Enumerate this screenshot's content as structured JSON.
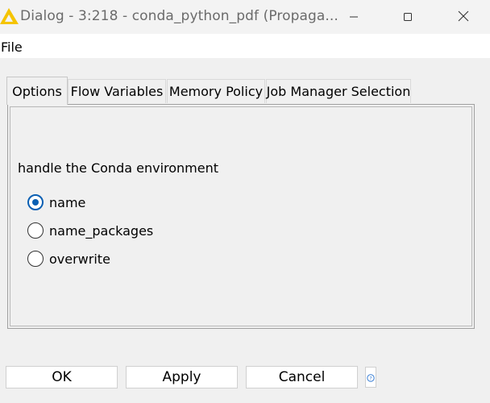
{
  "window": {
    "title": "Dialog - 3:218 - conda_python_pdf (Propaga...",
    "app_icon": "warning-triangle-icon",
    "controls": [
      "minimize-icon",
      "maximize-icon",
      "close-icon"
    ]
  },
  "menubar": {
    "items": [
      {
        "label": "File"
      }
    ]
  },
  "tabs": [
    {
      "label": "Options",
      "active": true
    },
    {
      "label": "Flow Variables",
      "active": false
    },
    {
      "label": "Memory Policy",
      "active": false
    },
    {
      "label": "Job Manager Selection",
      "active": false
    }
  ],
  "options": {
    "section_label": "handle the Conda environment",
    "radios": [
      {
        "label": "name",
        "checked": true
      },
      {
        "label": "name_packages",
        "checked": false
      },
      {
        "label": "overwrite",
        "checked": false
      }
    ]
  },
  "buttons": {
    "ok": "OK",
    "apply": "Apply",
    "cancel": "Cancel",
    "help_icon": "help-icon"
  },
  "colors": {
    "accent": "#0a5fb3",
    "icon_yellow": "#f5c400"
  }
}
